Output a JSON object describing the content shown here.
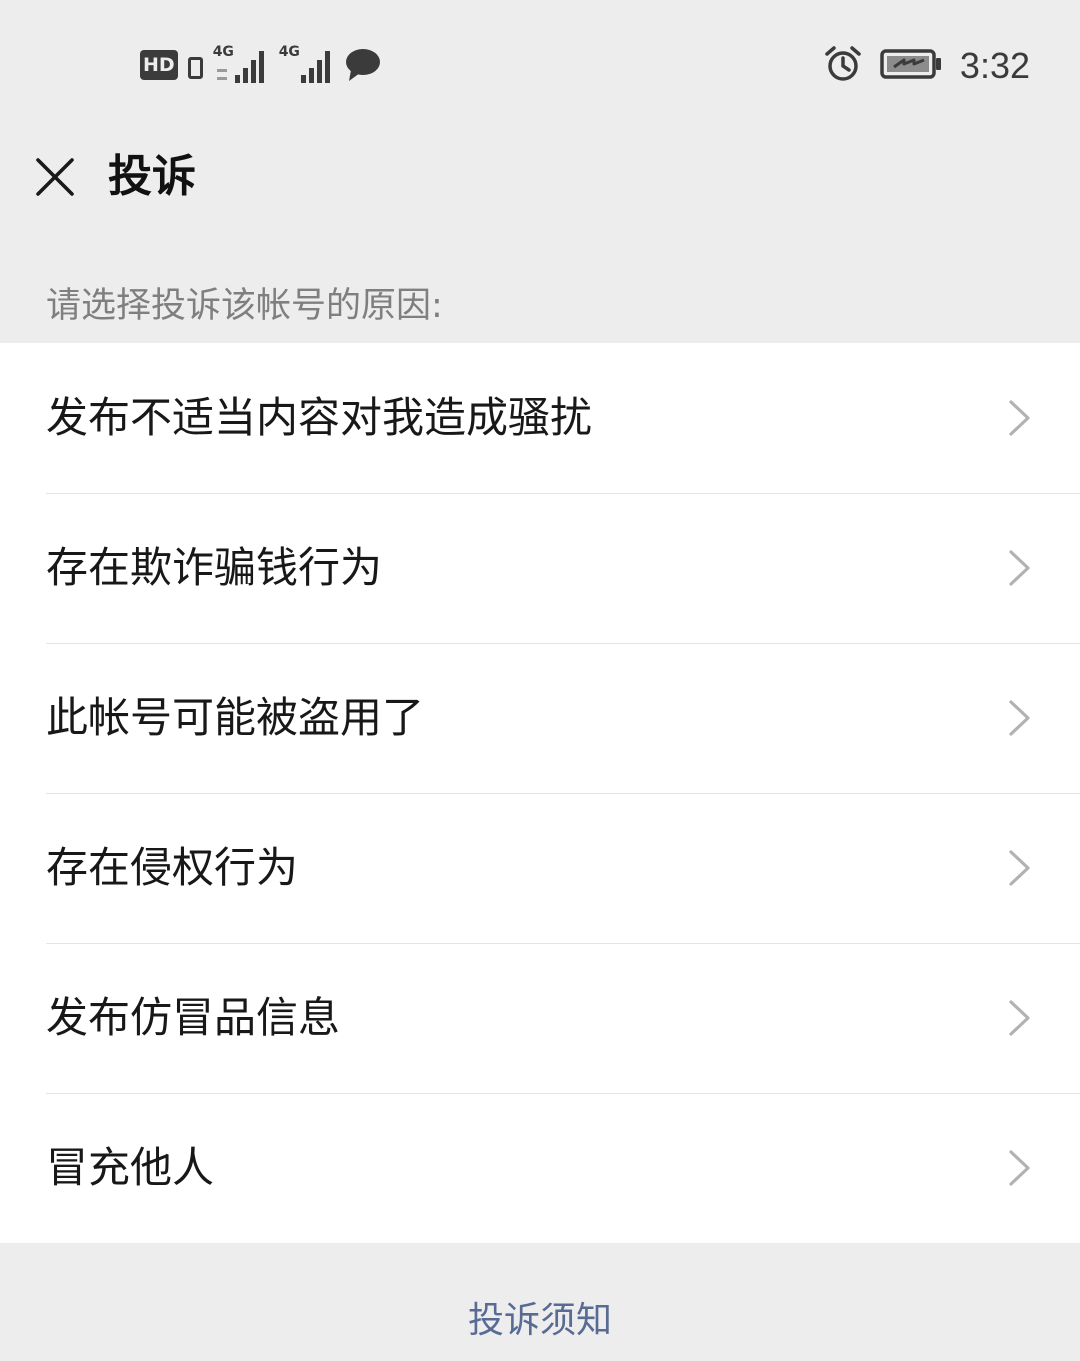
{
  "status_bar": {
    "hd_label": "HD",
    "network_1": "4G",
    "network_2": "4G",
    "time": "3:32"
  },
  "nav": {
    "title": "投诉"
  },
  "section": {
    "hint": "请选择投诉该帐号的原因:"
  },
  "reasons": [
    {
      "label": "发布不适当内容对我造成骚扰"
    },
    {
      "label": "存在欺诈骗钱行为"
    },
    {
      "label": "此帐号可能被盗用了"
    },
    {
      "label": "存在侵权行为"
    },
    {
      "label": "发布仿冒品信息"
    },
    {
      "label": "冒充他人"
    }
  ],
  "footer": {
    "link": "投诉须知"
  },
  "icons": {
    "close": "close-icon",
    "chevron": "chevron-right-icon",
    "alarm": "alarm-clock-icon",
    "battery": "battery-charging-icon",
    "chat": "message-bubble-icon",
    "signal": "signal-bars-icon",
    "sim": "sim-card-icon"
  },
  "colors": {
    "background": "#ededed",
    "list_background": "#ffffff",
    "hint_text": "#7f7f7f",
    "link": "#576b95",
    "chevron": "#b2b2b2"
  }
}
